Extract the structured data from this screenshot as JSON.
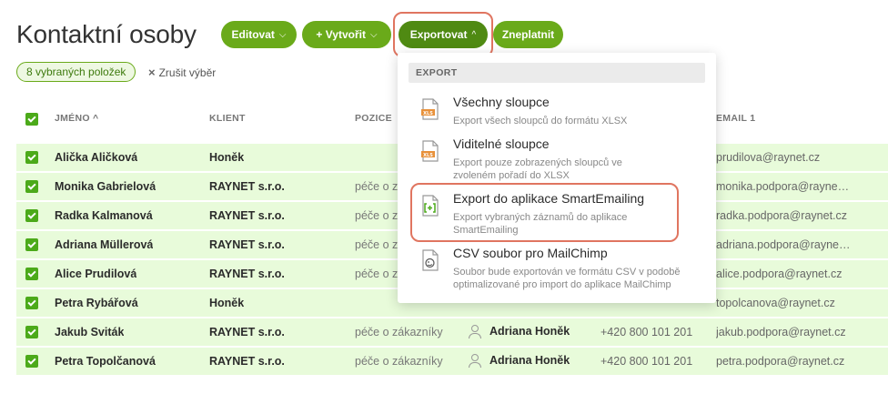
{
  "page": {
    "title": "Kontaktní osoby"
  },
  "toolbar": {
    "edit_label": "Editovat",
    "create_label": "+ Vytvořit",
    "export_label": "Exportovat",
    "invalidate_label": "Zneplatnit",
    "chev_down": "⌵",
    "chev_up": "^"
  },
  "selection": {
    "badge": "8 vybraných položek",
    "clear_label": "Zrušit výběr",
    "clear_icon": "×"
  },
  "columns": {
    "name": "JMÉNO ^",
    "client": "KLIENT",
    "position": "POZICE",
    "email": "EMAIL 1"
  },
  "rows": [
    {
      "name": "Alička Aličková",
      "client": "Honěk",
      "position": "",
      "owner": "",
      "phone": "",
      "email": "prudilova@raynet.cz"
    },
    {
      "name": "Monika Gabrielová",
      "client": "RAYNET s.r.o.",
      "position": "péče o zákazníky",
      "owner": "",
      "phone": "",
      "email": "monika.podpora@rayne…"
    },
    {
      "name": "Radka Kalmanová",
      "client": "RAYNET s.r.o.",
      "position": "péče o zákazníky",
      "owner": "",
      "phone": "",
      "email": "radka.podpora@raynet.cz"
    },
    {
      "name": "Adriana Müllerová",
      "client": "RAYNET s.r.o.",
      "position": "péče o zákazníky",
      "owner": "",
      "phone": "",
      "email": "adriana.podpora@rayne…"
    },
    {
      "name": "Alice Prudilová",
      "client": "RAYNET s.r.o.",
      "position": "péče o zákazníky",
      "owner": "",
      "phone": "",
      "email": "alice.podpora@raynet.cz"
    },
    {
      "name": "Petra Rybářová",
      "client": "Honěk",
      "position": "",
      "owner": "",
      "phone": "",
      "email": "topolcanova@raynet.cz"
    },
    {
      "name": "Jakub Sviták",
      "client": "RAYNET s.r.o.",
      "position": "péče o zákazníky",
      "owner": "Adriana Honěk",
      "phone": "+420 800 101 201",
      "email": "jakub.podpora@raynet.cz"
    },
    {
      "name": "Petra Topolčanová",
      "client": "RAYNET s.r.o.",
      "position": "péče o zákazníky",
      "owner": "Adriana Honěk",
      "phone": "+420 800 101 201",
      "email": "petra.podpora@raynet.cz"
    }
  ],
  "export_menu": {
    "header": "EXPORT",
    "items": [
      {
        "title": "Všechny sloupce",
        "desc": "Export všech sloupců do formátu XLSX",
        "icon": "xls-file-icon",
        "icon_text": "XLS"
      },
      {
        "title": "Viditelné sloupce",
        "desc": "Export pouze zobrazených sloupců ve zvoleném pořadí do XLSX",
        "icon": "xls-file-icon",
        "icon_text": "XLS"
      },
      {
        "title": "Export do aplikace SmartEmailing",
        "desc": "Export vybraných záznamů do aplikace SmartEmailing",
        "icon": "smartemailing-file-icon"
      },
      {
        "title": "CSV soubor pro MailChimp",
        "desc": "Soubor bude exportován ve formátu CSV v podobě optimalizované pro import do aplikace MailChimp",
        "icon": "mailchimp-file-icon"
      }
    ]
  },
  "colors": {
    "accent": "#6aaa1a",
    "row_bg": "#e8fbda",
    "highlight": "#e07560",
    "xls_orange": "#e8913a"
  }
}
